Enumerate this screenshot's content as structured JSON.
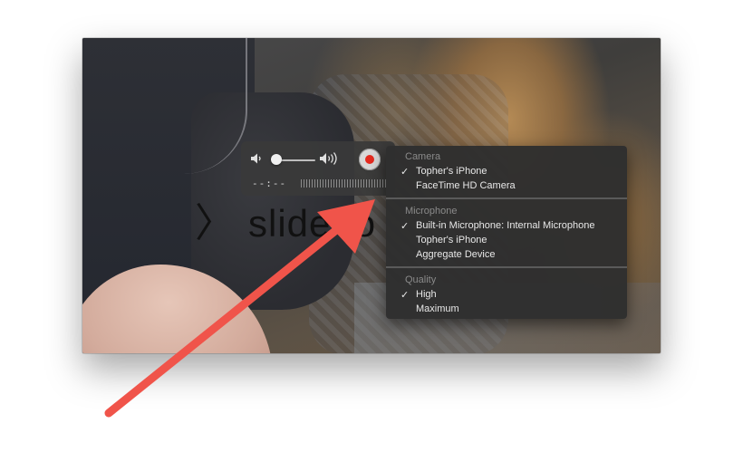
{
  "preview": {
    "overlay_text": "slide to"
  },
  "hud": {
    "time": "--:--",
    "volume_level": 0.0
  },
  "menu": {
    "sections": [
      {
        "header": "Camera",
        "items": [
          {
            "label": "Topher's iPhone",
            "checked": true
          },
          {
            "label": "FaceTime HD Camera",
            "checked": false
          }
        ]
      },
      {
        "header": "Microphone",
        "items": [
          {
            "label": "Built-in Microphone: Internal Microphone",
            "checked": true
          },
          {
            "label": "Topher's iPhone",
            "checked": false
          },
          {
            "label": "Aggregate Device",
            "checked": false
          }
        ]
      },
      {
        "header": "Quality",
        "items": [
          {
            "label": "High",
            "checked": true
          },
          {
            "label": "Maximum",
            "checked": false
          }
        ]
      }
    ],
    "check_glyph": "✓"
  },
  "icons": {
    "volume_low": "speaker-low-icon",
    "volume_high": "speaker-high-icon",
    "record": "record-icon",
    "camera": "camera-icon"
  },
  "colors": {
    "record_red": "#e52b20",
    "arrow": "#f0544a"
  }
}
